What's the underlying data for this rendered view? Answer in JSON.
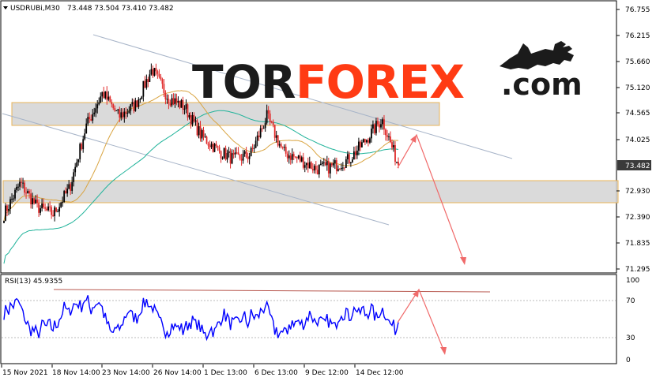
{
  "header": {
    "symbol_label": "USDRUBi,M30",
    "ohlc": "73.448 73.504 73.410 73.482"
  },
  "logo": {
    "part1": "TOR",
    "part2": "FOREX",
    "part3": ".com"
  },
  "price_axis": {
    "ticks": [
      "76.755",
      "76.215",
      "75.660",
      "75.120",
      "74.565",
      "74.025",
      "73.482",
      "72.930",
      "72.390",
      "71.835",
      "71.295"
    ],
    "current_price": "73.482"
  },
  "rsi": {
    "label": "RSI(13) 45.9355",
    "ticks": [
      "100",
      "70",
      "30",
      "0"
    ]
  },
  "time_axis": {
    "ticks": [
      "15 Nov 2021",
      "18 Nov 14:00",
      "23 Nov 14:00",
      "26 Nov 14:00",
      "1 Dec 13:00",
      "6 Dec 13:00",
      "9 Dec 12:00",
      "14 Dec 12:00"
    ]
  },
  "colors": {
    "bull_candle": "#000000",
    "bear_candle": "#e02a2a",
    "ma_fast": "#d9a441",
    "ma_slow": "#20b39a",
    "rsi_line": "#0000ff",
    "forecast_arrow": "#f06a6a",
    "channel_line": "#a7b4c8",
    "zone_fill": "#d3d3d3",
    "zone_border": "#e8b45a"
  },
  "chart_data": {
    "type": "candlestick",
    "timeframe": "M30",
    "ylim": [
      71.295,
      76.755
    ],
    "rsi_ylim": [
      0,
      100
    ],
    "rsi_levels": [
      30,
      70
    ],
    "close_path": [
      {
        "t": "15 Nov 2021",
        "close": 72.45
      },
      {
        "t": "16 Nov",
        "close": 73.1
      },
      {
        "t": "17 Nov",
        "close": 72.6
      },
      {
        "t": "18 Nov",
        "close": 72.45
      },
      {
        "t": "18 Nov 14:00",
        "close": 73.0
      },
      {
        "t": "19 Nov",
        "close": 74.3
      },
      {
        "t": "22 Nov",
        "close": 75.0
      },
      {
        "t": "23 Nov 14:00",
        "close": 74.5
      },
      {
        "t": "24 Nov",
        "close": 74.75
      },
      {
        "t": "25 Nov",
        "close": 75.5
      },
      {
        "t": "26 Nov 14:00",
        "close": 74.9
      },
      {
        "t": "29 Nov",
        "close": 74.7
      },
      {
        "t": "30 Nov",
        "close": 74.1
      },
      {
        "t": "1 Dec 13:00",
        "close": 73.8
      },
      {
        "t": "2 Dec",
        "close": 73.6
      },
      {
        "t": "3 Dec",
        "close": 73.7
      },
      {
        "t": "6 Dec 13:00",
        "close": 74.5
      },
      {
        "t": "7 Dec",
        "close": 73.75
      },
      {
        "t": "8 Dec",
        "close": 73.6
      },
      {
        "t": "9 Dec 12:00",
        "close": 73.4
      },
      {
        "t": "10 Dec",
        "close": 73.45
      },
      {
        "t": "13 Dec",
        "close": 73.6
      },
      {
        "t": "14 Dec",
        "close": 74.0
      },
      {
        "t": "14 Dec 12:00",
        "close": 74.45
      },
      {
        "t": "15 Dec",
        "close": 73.482
      }
    ],
    "resistance_zone": [
      74.4,
      74.85
    ],
    "support_zone": [
      72.8,
      73.2
    ],
    "forecast": [
      {
        "t": "15 Dec",
        "price": 73.55
      },
      {
        "t": "16 Dec",
        "price": 74.1
      },
      {
        "t": "17 Dec",
        "price": 71.8
      }
    ]
  }
}
